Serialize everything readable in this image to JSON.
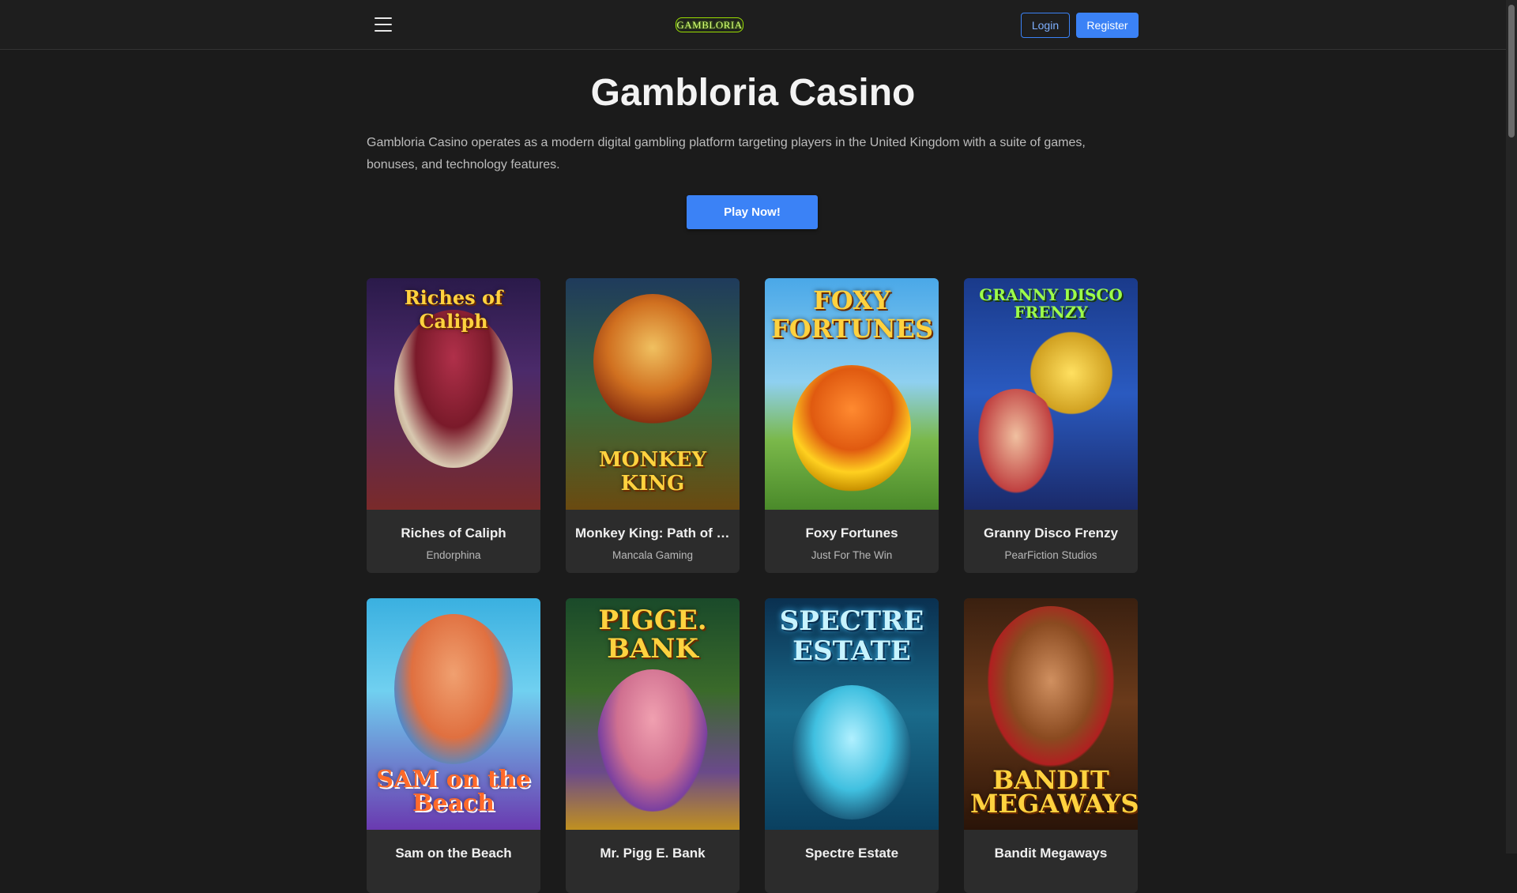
{
  "header": {
    "logo_text": "GAMBLORIA",
    "login_label": "Login",
    "register_label": "Register"
  },
  "hero": {
    "title": "Gambloria Casino",
    "description": "Gambloria Casino operates as a modern digital gambling platform targeting players in the United Kingdom with a suite of games, bonuses, and technology features.",
    "cta_label": "Play Now!"
  },
  "colors": {
    "accent": "#3b82f6",
    "background": "#1b1b1b",
    "card": "#2c2c2c",
    "logo": "#9be000"
  },
  "games": [
    {
      "name": "Riches of Caliph",
      "provider": "Endorphina",
      "art_text": "Riches of Caliph"
    },
    {
      "name": "Monkey King: Path of Treasure",
      "provider": "Mancala Gaming",
      "art_text": "MONKEY KING"
    },
    {
      "name": "Foxy Fortunes",
      "provider": "Just For The Win",
      "art_text": "FOXY FORTUNES"
    },
    {
      "name": "Granny Disco Frenzy",
      "provider": "PearFiction Studios",
      "art_text": "GRANNY DISCO FRENZY"
    },
    {
      "name": "Sam on the Beach",
      "provider": "",
      "art_text": "SAM on the Beach"
    },
    {
      "name": "Mr. Pigg E. Bank",
      "provider": "",
      "art_text": "PIGGE. BANK"
    },
    {
      "name": "Spectre Estate",
      "provider": "",
      "art_text": "SPECTRE ESTATE"
    },
    {
      "name": "Bandit Megaways",
      "provider": "",
      "art_text": "BANDIT MEGAWAYS"
    }
  ]
}
